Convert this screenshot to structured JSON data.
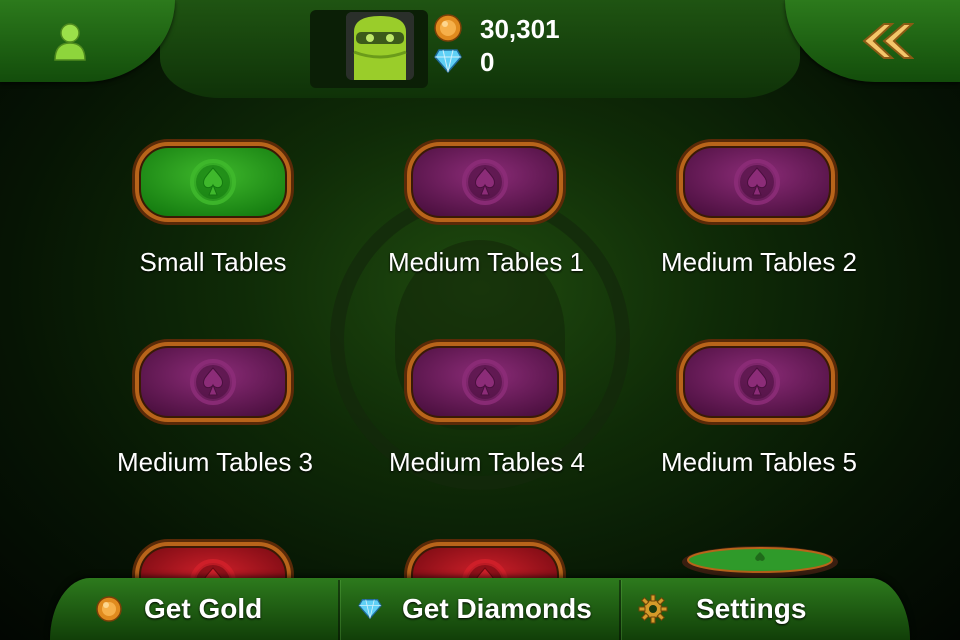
{
  "header": {
    "gold_amount": "30,301",
    "diamond_amount": "0",
    "icons": {
      "profile": "user-silhouette-icon",
      "back": "double-chevron-left-icon",
      "gold": "gold-coin-icon",
      "diamond": "diamond-icon"
    }
  },
  "tables": [
    {
      "label": "Small Tables",
      "color": "green"
    },
    {
      "label": "Medium Tables 1",
      "color": "purple"
    },
    {
      "label": "Medium Tables 2",
      "color": "purple"
    },
    {
      "label": "Medium Tables 3",
      "color": "purple"
    },
    {
      "label": "Medium Tables 4",
      "color": "purple"
    },
    {
      "label": "Medium Tables 5",
      "color": "purple"
    },
    {
      "label": "",
      "color": "red"
    },
    {
      "label": "",
      "color": "red"
    },
    {
      "label": "",
      "color": "table"
    }
  ],
  "colors": {
    "green": "#1f8a1a",
    "purple": "#6b1d5c",
    "red": "#a3101a",
    "frame": "#b8641a"
  },
  "bottom_bar": {
    "get_gold": "Get Gold",
    "get_diamonds": "Get Diamonds",
    "settings": "Settings",
    "icons": {
      "gold": "gold-coin-icon",
      "diamonds": "diamond-icon",
      "settings": "gear-icon"
    }
  }
}
